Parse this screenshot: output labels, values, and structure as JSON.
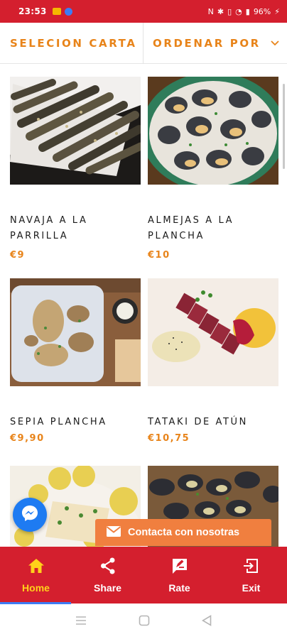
{
  "status_bar": {
    "time": "23:53",
    "battery": "96%"
  },
  "filters": {
    "selection_label": "SELECION CARTA",
    "order_label": "ORDENAR POR"
  },
  "items": [
    {
      "name": "NAVAJA A LA PARRILLA",
      "price": "€9"
    },
    {
      "name": "ALMEJAS A LA PLANCHA",
      "price": "€10"
    },
    {
      "name": "SEPIA PLANCHA",
      "price": "€9,90"
    },
    {
      "name": "TATAKI DE ATÚN",
      "price": "€10,75"
    },
    {
      "name": "",
      "price": ""
    },
    {
      "name": "",
      "price": ""
    }
  ],
  "contact_button": {
    "label": "Contacta con nosotras"
  },
  "bottom_nav": [
    {
      "label": "Home",
      "icon": "home-icon"
    },
    {
      "label": "Share",
      "icon": "share-icon"
    },
    {
      "label": "Rate",
      "icon": "rate-icon"
    },
    {
      "label": "Exit",
      "icon": "exit-icon"
    }
  ],
  "colors": {
    "brand_red": "#d41f2e",
    "accent_orange": "#e8841a",
    "active_nav": "#ffd21a",
    "contact_bg": "#f07f3f",
    "messenger_blue": "#1e7bf2"
  }
}
